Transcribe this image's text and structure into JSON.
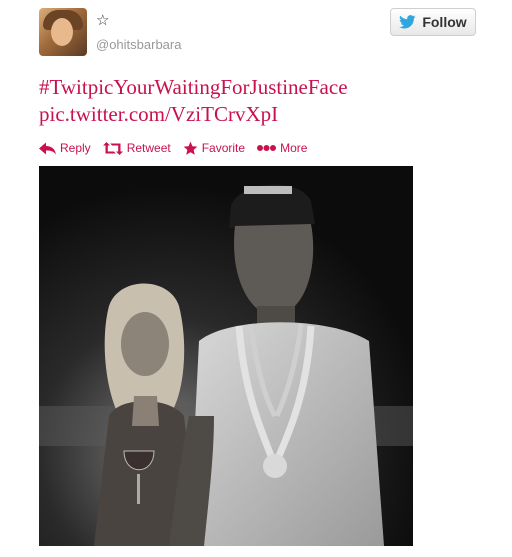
{
  "user": {
    "handle": "@ohitsbarbara"
  },
  "follow_button": {
    "label": "Follow"
  },
  "tweet": {
    "hashtag": "#TwitpicYourWaitingForJustineFace",
    "link": "pic.twitter.com/VziTCrvXpI"
  },
  "actions": {
    "reply": "Reply",
    "retweet": "Retweet",
    "favorite": "Favorite",
    "more": "More"
  },
  "colors": {
    "link": "#c8124c",
    "twitter_blue": "#2fa6e0",
    "muted": "#999999"
  },
  "icons": {
    "star": "star-icon",
    "bird": "twitter-bird-icon",
    "reply": "reply-arrow-icon",
    "retweet": "retweet-icon",
    "favorite": "favorite-star-icon",
    "more": "more-dots-icon"
  }
}
